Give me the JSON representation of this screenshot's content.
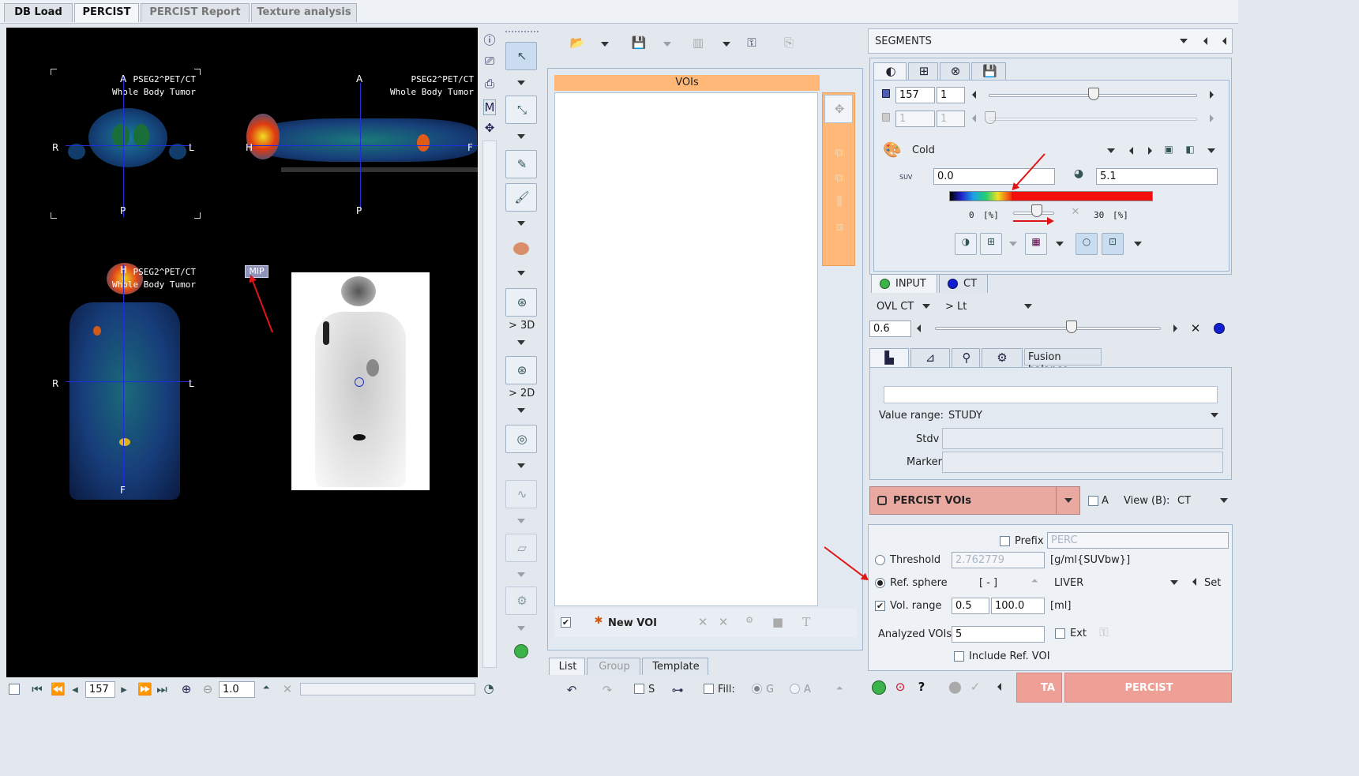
{
  "tabs": [
    "DB Load",
    "PERCIST",
    "PERCIST Report",
    "Texture analysis"
  ],
  "viewer": {
    "patient": "PSEG2^PET/CT",
    "study": "Whole Body Tumor",
    "axial": {
      "top": "A",
      "bottom": "P",
      "left": "R",
      "right": "L"
    },
    "sagittal": {
      "top": "A",
      "bottom": "P",
      "left": "H",
      "right": "F"
    },
    "coronal": {
      "top": "H",
      "bottom": "F",
      "left": "R",
      "right": "L"
    },
    "mip_label": "MIP",
    "tool_3d": "> 3D",
    "tool_2d": "> 2D",
    "slice": "157",
    "zoom": "1.0"
  },
  "voi": {
    "header": "VOIs",
    "new_voi": "New VOI",
    "bottom_tabs": [
      "List",
      "Group",
      "Template"
    ],
    "s_label": "S",
    "fill_label": "Fill:",
    "g_label": "G",
    "a_label": "A"
  },
  "segments": {
    "title": "SEGMENTS",
    "frame": "157",
    "frame_step": "1",
    "frame2": "1",
    "frame2_step": "1",
    "colormap": "Cold",
    "suv_icon": "SUV",
    "min": "0.0",
    "max": "5.1",
    "pct_low": "0",
    "pct_high": "30",
    "pct_unit": "[%]",
    "input_tab": "INPUT",
    "ct_tab": "CT",
    "ovl_label": "OVL CT",
    "ovl_mode": "> Lt",
    "fusion_value": "0.6",
    "fusion_tooltip": "Fusion balance",
    "value_range_label": "Value range:",
    "value_range": "STUDY",
    "stdv_label": "Stdv",
    "marker_label": "Marker"
  },
  "percist": {
    "title": "PERCIST VOIs",
    "a_label": "A",
    "view_label": "View (B):",
    "view_value": "CT",
    "prefix_label": "Prefix",
    "prefix_value": "PERC",
    "threshold_label": "Threshold",
    "threshold_value": "2.762779",
    "threshold_unit": "[g/ml{SUVbw}]",
    "ref_label": "Ref. sphere",
    "ref_unit": "[ - ]",
    "ref_value": "LIVER",
    "set_label": "Set",
    "vol_label": "Vol. range",
    "vol_min": "0.5",
    "vol_max": "100.0",
    "vol_unit": "[ml]",
    "analyzed_label": "Analyzed VOIs",
    "analyzed_value": "5",
    "ext_label": "Ext",
    "include_label": "Include Ref. VOI",
    "ta_button": "TA",
    "percist_button": "PERCIST"
  },
  "colors": {
    "tab_bg": "#dfe4ea",
    "orange": "#ffb877",
    "red_button": "#e9a8a0",
    "annot_arrow": "#e01616",
    "crosshair": "#1f2ed8"
  }
}
